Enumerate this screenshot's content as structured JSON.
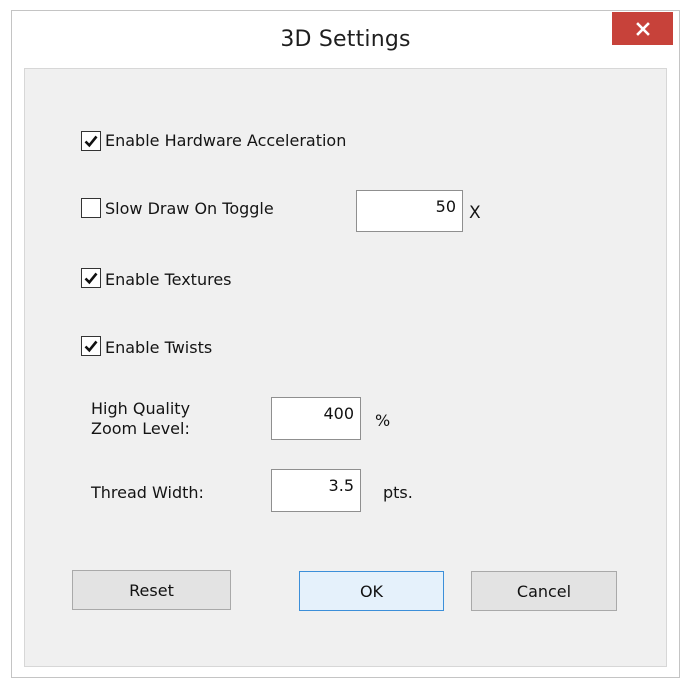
{
  "window": {
    "title": "3D Settings",
    "close_icon": "close-icon"
  },
  "options": {
    "hardware_acceleration": {
      "label": "Enable Hardware Acceleration",
      "checked": true
    },
    "slow_draw": {
      "label": "Slow Draw On Toggle",
      "checked": false,
      "value": "50",
      "unit": "X"
    },
    "textures": {
      "label": "Enable Textures",
      "checked": true
    },
    "twists": {
      "label": "Enable Twists",
      "checked": true
    }
  },
  "zoom": {
    "label_line1": "High Quality",
    "label_line2": "Zoom Level:",
    "value": "400",
    "unit": "%"
  },
  "thread": {
    "label": "Thread Width:",
    "value": "3.5",
    "unit": "pts."
  },
  "buttons": {
    "reset": "Reset",
    "ok": "OK",
    "cancel": "Cancel"
  },
  "colors": {
    "close_button": "#c7423a",
    "default_button_border": "#3c8fd9",
    "client_bg": "#f0f0f0"
  }
}
